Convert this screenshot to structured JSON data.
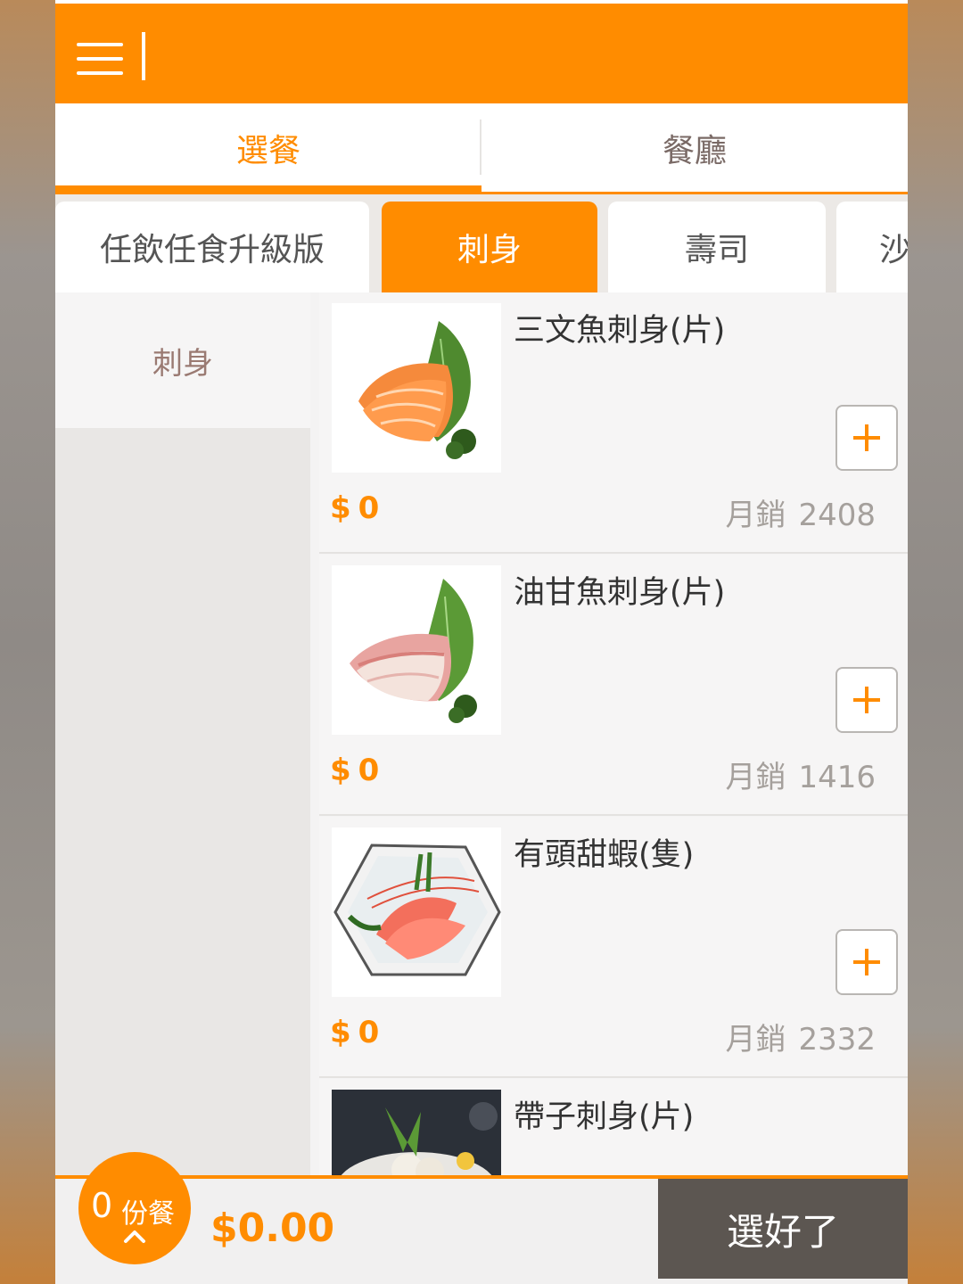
{
  "header": {
    "menu_icon": "hamburger-menu-icon"
  },
  "main_tabs": [
    {
      "label": "選餐",
      "active": true
    },
    {
      "label": "餐廳",
      "active": false
    }
  ],
  "categories": [
    {
      "label": "任飲任食升級版",
      "active": false
    },
    {
      "label": "刺身",
      "active": true
    },
    {
      "label": "壽司",
      "active": false
    },
    {
      "label": "沙",
      "active": false
    }
  ],
  "sidebar": {
    "items": [
      {
        "label": "刺身",
        "selected": true
      }
    ]
  },
  "menu_items": [
    {
      "name": "三文魚刺身(片)",
      "currency": "$",
      "price": "0",
      "sales_label": "月銷",
      "sales": "2408",
      "image": "salmon-sashimi"
    },
    {
      "name": "油甘魚刺身(片)",
      "currency": "$",
      "price": "0",
      "sales_label": "月銷",
      "sales": "1416",
      "image": "yellowtail-sashimi"
    },
    {
      "name": "有頭甜蝦(隻)",
      "currency": "$",
      "price": "0",
      "sales_label": "月銷",
      "sales": "2332",
      "image": "sweet-shrimp"
    },
    {
      "name": "帶子刺身(片)",
      "image": "scallop-sashimi"
    }
  ],
  "cart": {
    "count": "0",
    "unit": "份餐",
    "total": "$0.00",
    "confirm_label": "選好了"
  },
  "colors": {
    "accent": "#ff8c00",
    "dark_button": "#5c5651"
  }
}
